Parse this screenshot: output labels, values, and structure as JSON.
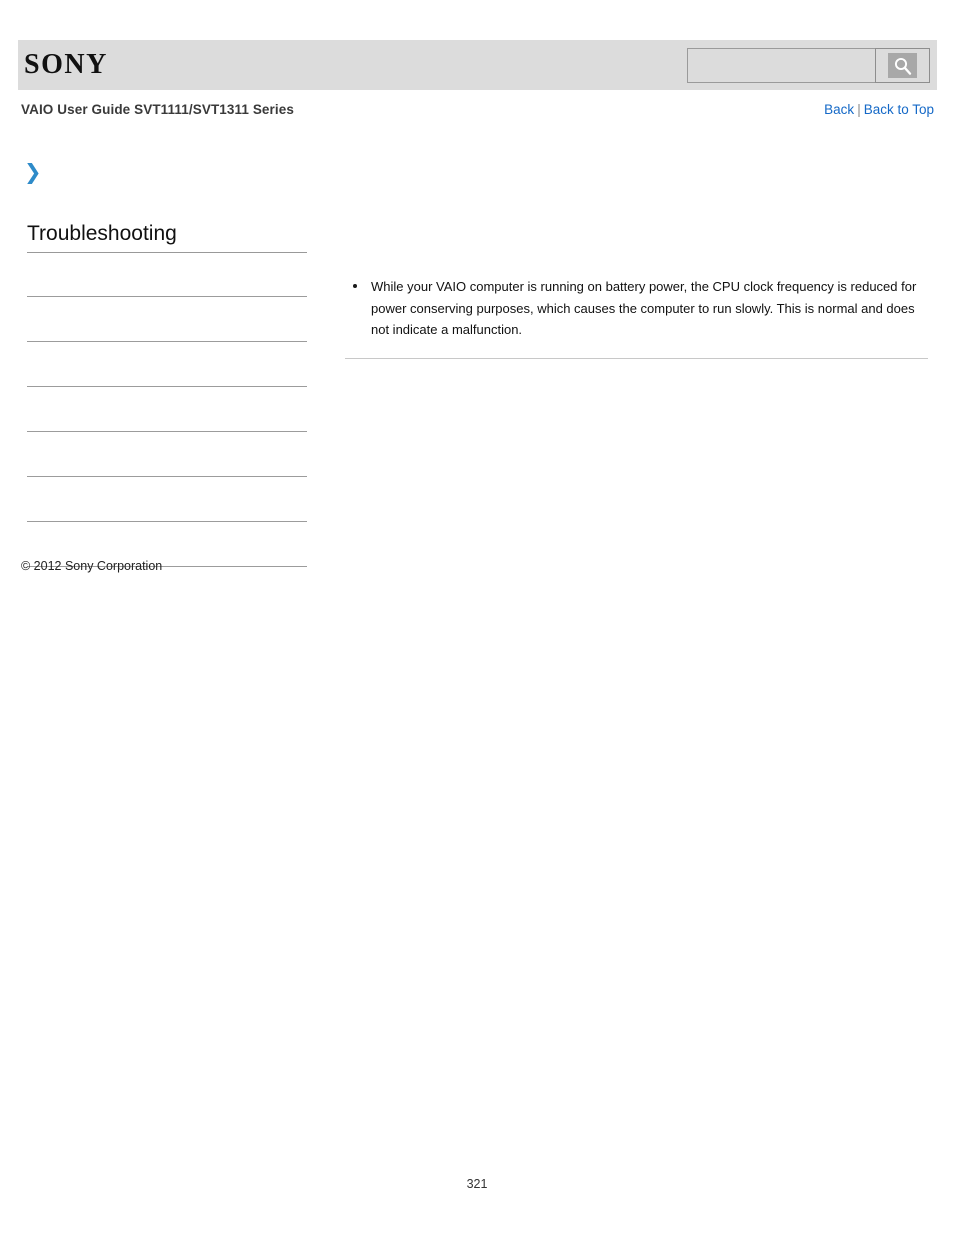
{
  "header": {
    "logo_text": "SONY",
    "search": {
      "value": "",
      "placeholder": "",
      "icon": "search-icon",
      "button_label": ""
    }
  },
  "subheader": {
    "doc_title": "VAIO User Guide SVT1111/SVT1311 Series",
    "nav": {
      "back_label": "Back",
      "separator": "|",
      "back_to_top_label": "Back to Top"
    }
  },
  "sidebar": {
    "expand_icon": "chevron-right-icon",
    "chevron_glyph": "❯",
    "heading": "Troubleshooting",
    "items": [
      {
        "label": ""
      },
      {
        "label": ""
      },
      {
        "label": ""
      },
      {
        "label": ""
      },
      {
        "label": ""
      },
      {
        "label": ""
      },
      {
        "label": ""
      }
    ],
    "copyright": "© 2012 Sony Corporation"
  },
  "main": {
    "bullets": [
      "While your VAIO computer is running on battery power, the CPU clock frequency is reduced for power conserving purposes, which causes the computer to run slowly. This is normal and does not indicate a malfunction."
    ]
  },
  "footer": {
    "page_number": "321"
  },
  "colors": {
    "link": "#1569c7",
    "header_band": "#dcdcdc",
    "chevron": "#2e8bc9",
    "divider": "#9c9c9c"
  }
}
